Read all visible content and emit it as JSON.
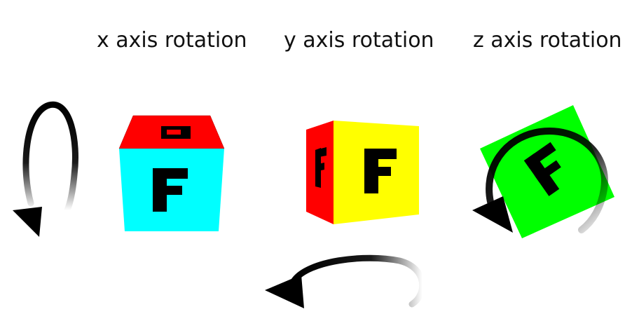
{
  "labels": {
    "x": "x axis rotation",
    "y": "y axis rotation",
    "z": "z axis rotation"
  },
  "face_letter": "F",
  "colors": {
    "cube_x_top": "#ff0000",
    "cube_x_front": "#00ffff",
    "cube_y_side": "#ff0000",
    "cube_y_front": "#ffff00",
    "cube_z_front": "#00ff00",
    "letter": "#000000",
    "arrow": "#000000"
  },
  "icons": [
    "rotation-arrow-icon"
  ]
}
